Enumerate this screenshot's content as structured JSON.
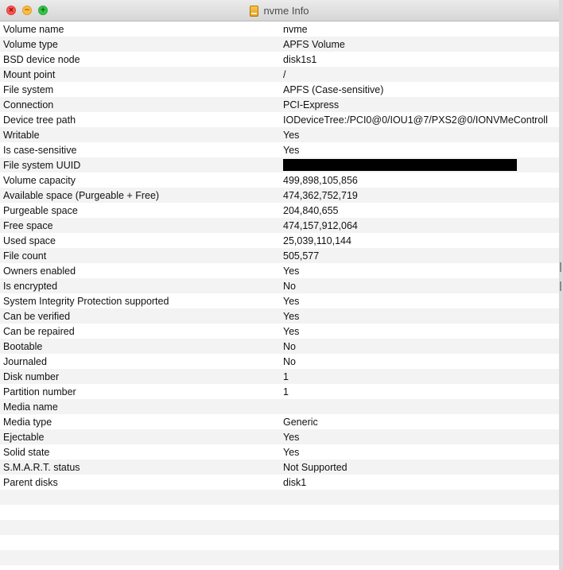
{
  "window": {
    "title": "nvme Info",
    "icons": {
      "close": "close-icon",
      "minimize": "minimize-icon",
      "zoom": "zoom-icon",
      "title_icon": "external-disk-icon"
    }
  },
  "info": {
    "rows": [
      {
        "key": "Volume name",
        "value": "nvme"
      },
      {
        "key": "Volume type",
        "value": "APFS Volume"
      },
      {
        "key": "BSD device node",
        "value": "disk1s1"
      },
      {
        "key": "Mount point",
        "value": "/"
      },
      {
        "key": "File system",
        "value": "APFS (Case-sensitive)"
      },
      {
        "key": "Connection",
        "value": "PCI-Express"
      },
      {
        "key": "Device tree path",
        "value": "IODeviceTree:/PCI0@0/IOU1@7/PXS2@0/IONVMeControll"
      },
      {
        "key": "Writable",
        "value": "Yes"
      },
      {
        "key": "Is case-sensitive",
        "value": "Yes"
      },
      {
        "key": "File system UUID",
        "value": ""
      },
      {
        "key": "Volume capacity",
        "value": "499,898,105,856"
      },
      {
        "key": "Available space (Purgeable + Free)",
        "value": "474,362,752,719"
      },
      {
        "key": "Purgeable space",
        "value": "204,840,655"
      },
      {
        "key": "Free space",
        "value": "474,157,912,064"
      },
      {
        "key": "Used space",
        "value": "25,039,110,144"
      },
      {
        "key": "File count",
        "value": "505,577"
      },
      {
        "key": "Owners enabled",
        "value": "Yes"
      },
      {
        "key": "Is encrypted",
        "value": "No"
      },
      {
        "key": "System Integrity Protection supported",
        "value": "Yes"
      },
      {
        "key": "Can be verified",
        "value": "Yes"
      },
      {
        "key": "Can be repaired",
        "value": "Yes"
      },
      {
        "key": "Bootable",
        "value": "No"
      },
      {
        "key": "Journaled",
        "value": "No"
      },
      {
        "key": "Disk number",
        "value": "1"
      },
      {
        "key": "Partition number",
        "value": "1"
      },
      {
        "key": "Media name",
        "value": ""
      },
      {
        "key": "Media type",
        "value": "Generic"
      },
      {
        "key": "Ejectable",
        "value": "Yes"
      },
      {
        "key": "Solid state",
        "value": "Yes"
      },
      {
        "key": "S.M.A.R.T. status",
        "value": "Not Supported"
      },
      {
        "key": "Parent disks",
        "value": "disk1"
      },
      {
        "key": "",
        "value": ""
      },
      {
        "key": "",
        "value": ""
      },
      {
        "key": "",
        "value": ""
      },
      {
        "key": "",
        "value": ""
      },
      {
        "key": "",
        "value": ""
      }
    ]
  }
}
